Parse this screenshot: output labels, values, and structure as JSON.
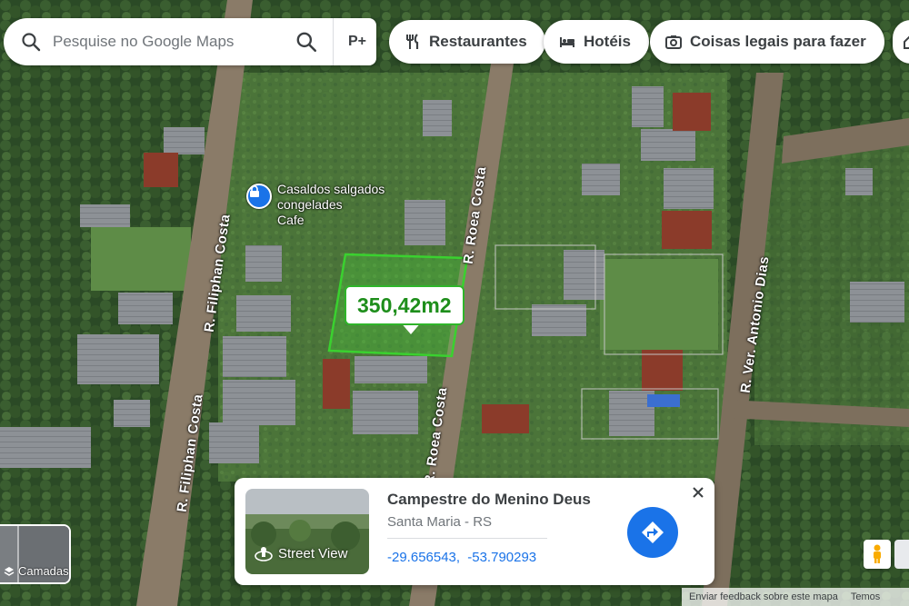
{
  "search": {
    "placeholder": "Pesquise no Google Maps",
    "extra_button": "P+"
  },
  "chips": [
    {
      "label": "Restaurantes",
      "icon": "fork-knife-icon"
    },
    {
      "label": "Hotéis",
      "icon": "bed-icon"
    },
    {
      "label": "Coisas legais para fazer",
      "icon": "camera-icon"
    }
  ],
  "map": {
    "area_measurement": "350,42m2",
    "roads": [
      "R. Filiphan Costa",
      "R. Filiphan Costa",
      "R. Roea Costa",
      "R. Roea Costa",
      "R. Ver. Antonio Dias"
    ],
    "poi": {
      "name_line1": "Casaldos salgados",
      "name_line2": "congelades",
      "category": "Cafe",
      "icon": "lock-pin-icon"
    }
  },
  "card": {
    "title": "Campestre do Menino Deus",
    "subtitle": "Santa Maria - RS",
    "latitude": "-29.656543,",
    "longitude": "-53.790293",
    "street_view_label": "Street View"
  },
  "layers_label": "Camadas",
  "footer": {
    "feedback": "Enviar feedback sobre este mapa",
    "terms": "Temos"
  },
  "colors": {
    "accent": "#1a73e8",
    "area_outline": "#3ad12f"
  }
}
